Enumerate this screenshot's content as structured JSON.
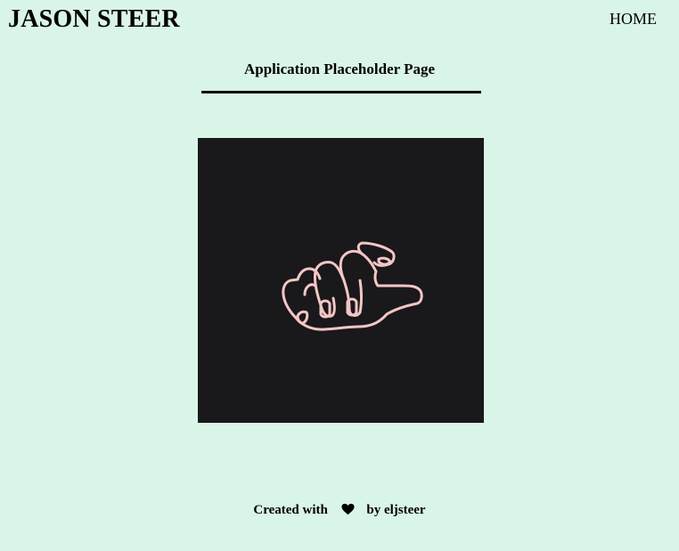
{
  "header": {
    "site_title": "JASON STEER",
    "nav_home_label": "HOME"
  },
  "main": {
    "page_heading": "Application Placeholder Page",
    "image": {
      "subject": "pointing-hand-line-drawing",
      "background_color": "#19181b",
      "line_color": "#f4c6c4"
    }
  },
  "footer": {
    "created_with_label": "Created with",
    "heart_icon": "heart-icon",
    "by_label": "by eljsteer"
  },
  "colors": {
    "page_background": "#d9f5e8",
    "text": "#000000"
  }
}
